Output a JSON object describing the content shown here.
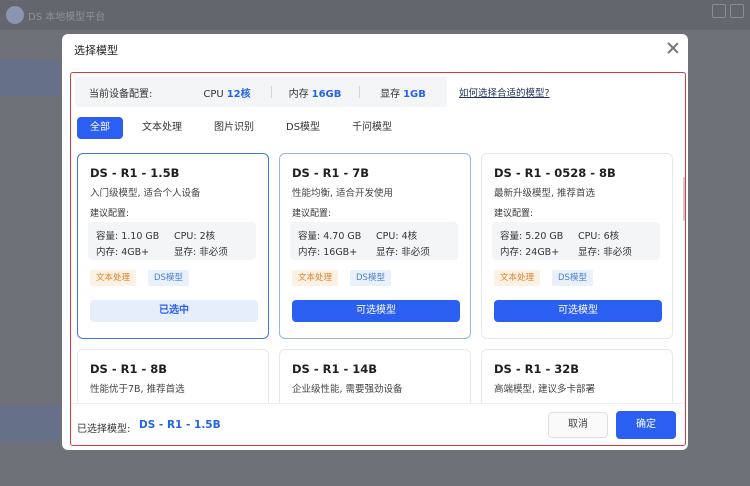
{
  "app": {
    "title": "DS 本地模型平台"
  },
  "modal": {
    "title": "选择模型",
    "help_link": "如何选择合适的模型?"
  },
  "device_config": {
    "label": "当前设备配置:",
    "cpu_label": "CPU",
    "cpu_value": "12核",
    "mem_label": "内存",
    "mem_value": "16GB",
    "gpu_label": "显存",
    "gpu_value": "1GB"
  },
  "tabs": [
    {
      "label": "全部",
      "active": true
    },
    {
      "label": "文本处理"
    },
    {
      "label": "图片识别"
    },
    {
      "label": "DS模型"
    },
    {
      "label": "千问模型"
    }
  ],
  "spec_labels": {
    "capacity": "容量:",
    "cpu": "CPU:",
    "memory": "内存:",
    "vram": "显存:",
    "recommended": "建议配置:"
  },
  "tags": {
    "text": "文本处理",
    "ds": "DS模型"
  },
  "cards": [
    {
      "name": "DS - R1 - 1.5B",
      "desc": "入门级模型, 适合个人设备",
      "capacity": "1.10 GB",
      "cpu": "2核",
      "memory": "4GB+",
      "vram": "非必须",
      "button": "已选中",
      "state": "selected"
    },
    {
      "name": "DS - R1 - 7B",
      "desc": "性能均衡, 适合开发使用",
      "capacity": "4.70 GB",
      "cpu": "4核",
      "memory": "16GB+",
      "vram": "非必须",
      "button": "可选模型",
      "state": "hover"
    },
    {
      "name": "DS - R1 - 0528 - 8B",
      "desc": "最新升级模型, 推荐首选",
      "capacity": "5.20 GB",
      "cpu": "6核",
      "memory": "24GB+",
      "vram": "非必须",
      "button": "可选模型",
      "state": "normal"
    },
    {
      "name": "DS - R1 - 8B",
      "desc": "性能优于7B, 推荐首选"
    },
    {
      "name": "DS - R1 - 14B",
      "desc": "企业级性能, 需要强劲设备"
    },
    {
      "name": "DS - R1 - 32B",
      "desc": "高端模型, 建议多卡部署"
    }
  ],
  "footer": {
    "selected_label": "已选择模型:",
    "selected_value": "DS - R1 - 1.5B",
    "cancel": "取消",
    "confirm": "确定"
  }
}
